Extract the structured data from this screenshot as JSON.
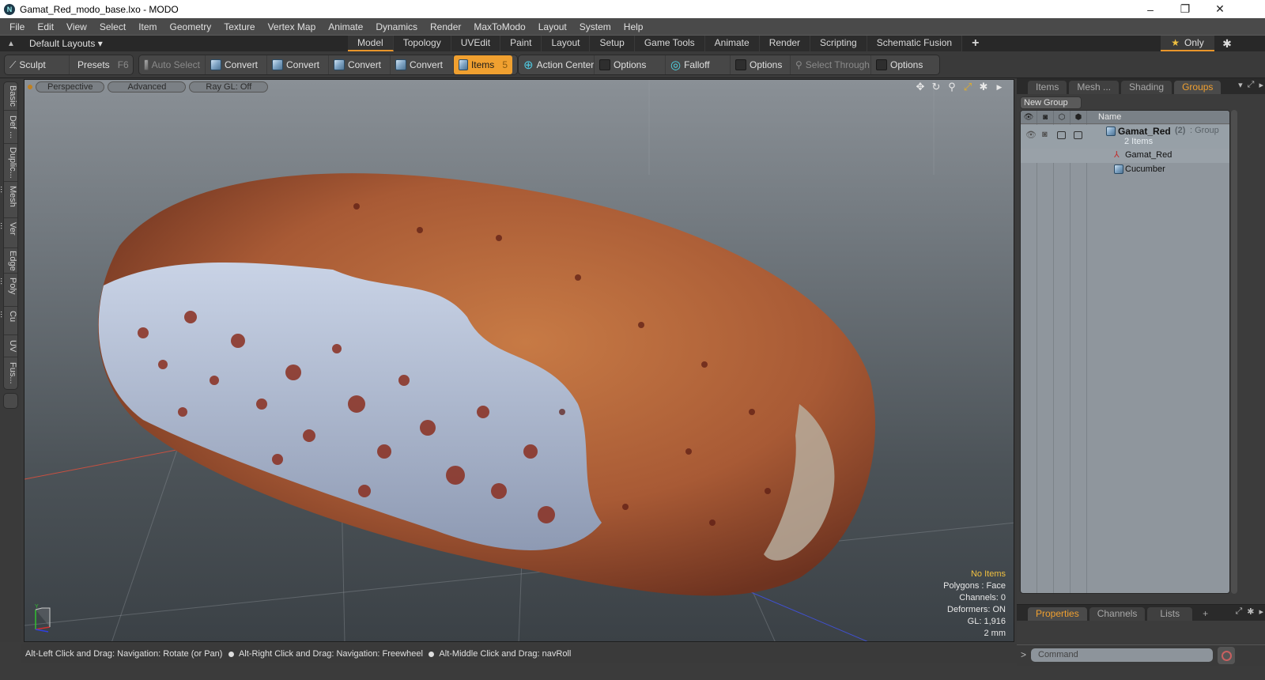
{
  "window": {
    "title": "Gamat_Red_modo_base.lxo - MODO",
    "controls": {
      "minimize": "–",
      "maximize": "❐",
      "close": "✕"
    }
  },
  "menu": [
    "File",
    "Edit",
    "View",
    "Select",
    "Item",
    "Geometry",
    "Texture",
    "Vertex Map",
    "Animate",
    "Dynamics",
    "Render",
    "MaxToModo",
    "Layout",
    "System",
    "Help"
  ],
  "layoutbar": {
    "layouts_label": "Default Layouts ▾",
    "tabs": [
      "Model",
      "Topology",
      "UVEdit",
      "Paint",
      "Layout",
      "Setup",
      "Game Tools",
      "Animate",
      "Render",
      "Scripting",
      "Schematic Fusion"
    ],
    "active_tab": "Model",
    "add_tab": "+",
    "only_label": "Only",
    "only_icon": "★"
  },
  "toolbar": {
    "sculpt": "Sculpt",
    "presets": "Presets",
    "presets_key": "F6",
    "auto_select": "Auto Select",
    "convert1": "Convert",
    "convert2": "Convert",
    "convert3": "Convert",
    "convert4": "Convert",
    "items": "Items",
    "items_key": "5",
    "action_center": "Action Center",
    "options1": "Options",
    "falloff": "Falloff",
    "options2": "Options",
    "select_through": "Select Through",
    "options3": "Options"
  },
  "side_tabs": [
    "Basic",
    "Def ...",
    "Duplic...",
    "Mesh ...",
    "Ver ...",
    "Edge",
    "Poly ...",
    "Cu ...",
    "UV",
    "Fus..."
  ],
  "viewport": {
    "view": "Perspective",
    "shading": "Advanced",
    "raygl": "Ray GL: Off",
    "info": {
      "selection": "No Items",
      "polygons": "Polygons : Face",
      "channels": "Channels: 0",
      "deformers": "Deformers: ON",
      "gl": "GL: 1,916",
      "unit": "2 mm"
    },
    "axis_label": "Y"
  },
  "statusbar": {
    "hint1": "Alt-Left Click and Drag: Navigation: Rotate (or Pan)",
    "hint2": "Alt-Right Click and Drag: Navigation: Freewheel",
    "hint3": "Alt-Middle Click and Drag: navRoll"
  },
  "right_panel": {
    "tabs": [
      "Items",
      "Mesh ...",
      "Shading",
      "Groups"
    ],
    "active_tab": "Groups",
    "new_group": "New Group",
    "column_name": "Name",
    "tree": {
      "group_name": "Gamat_Red",
      "group_count": "(2)",
      "group_type": ": Group",
      "group_sub": "2 Items",
      "children": [
        {
          "name": "Gamat_Red",
          "icon": "locator-icon"
        },
        {
          "name": "Cucumber",
          "icon": "mesh-icon"
        }
      ]
    },
    "bottom_tabs": [
      "Properties",
      "Channels",
      "Lists"
    ],
    "bottom_active": "Properties",
    "add_tab": "+"
  },
  "command": {
    "prompt": ">",
    "placeholder": "Command"
  }
}
